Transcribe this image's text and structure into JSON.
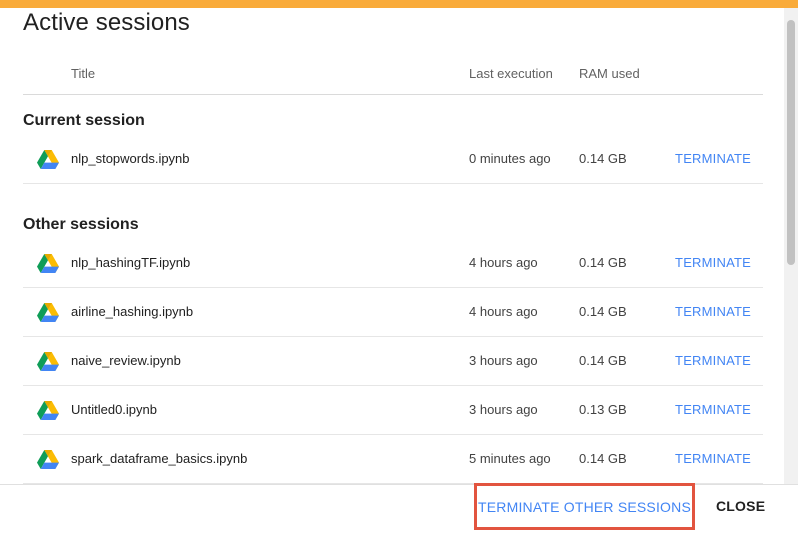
{
  "dialog": {
    "title": "Active sessions",
    "accent_color": "#f9ab3a",
    "link_color": "#4285f4"
  },
  "columns": {
    "title": "Title",
    "last_execution": "Last execution",
    "ram_used": "RAM used"
  },
  "current_section": {
    "label": "Current session",
    "sessions": [
      {
        "icon": "google-drive-icon",
        "name": "nlp_stopwords.ipynb",
        "last_execution": "0 minutes ago",
        "ram": "0.14 GB",
        "action": "TERMINATE"
      }
    ]
  },
  "other_section": {
    "label": "Other sessions",
    "sessions": [
      {
        "icon": "google-drive-icon",
        "name": "nlp_hashingTF.ipynb",
        "last_execution": "4 hours ago",
        "ram": "0.14 GB",
        "action": "TERMINATE"
      },
      {
        "icon": "google-drive-icon",
        "name": "airline_hashing.ipynb",
        "last_execution": "4 hours ago",
        "ram": "0.14 GB",
        "action": "TERMINATE"
      },
      {
        "icon": "google-drive-icon",
        "name": "naive_review.ipynb",
        "last_execution": "3 hours ago",
        "ram": "0.14 GB",
        "action": "TERMINATE"
      },
      {
        "icon": "google-drive-icon",
        "name": "Untitled0.ipynb",
        "last_execution": "3 hours ago",
        "ram": "0.13 GB",
        "action": "TERMINATE"
      },
      {
        "icon": "google-drive-icon",
        "name": "spark_dataframe_basics.ipynb",
        "last_execution": "5 minutes ago",
        "ram": "0.14 GB",
        "action": "TERMINATE"
      }
    ]
  },
  "footer": {
    "terminate_others": "TERMINATE OTHER SESSIONS",
    "highlight_color": "#e2543f",
    "close": "CLOSE"
  }
}
